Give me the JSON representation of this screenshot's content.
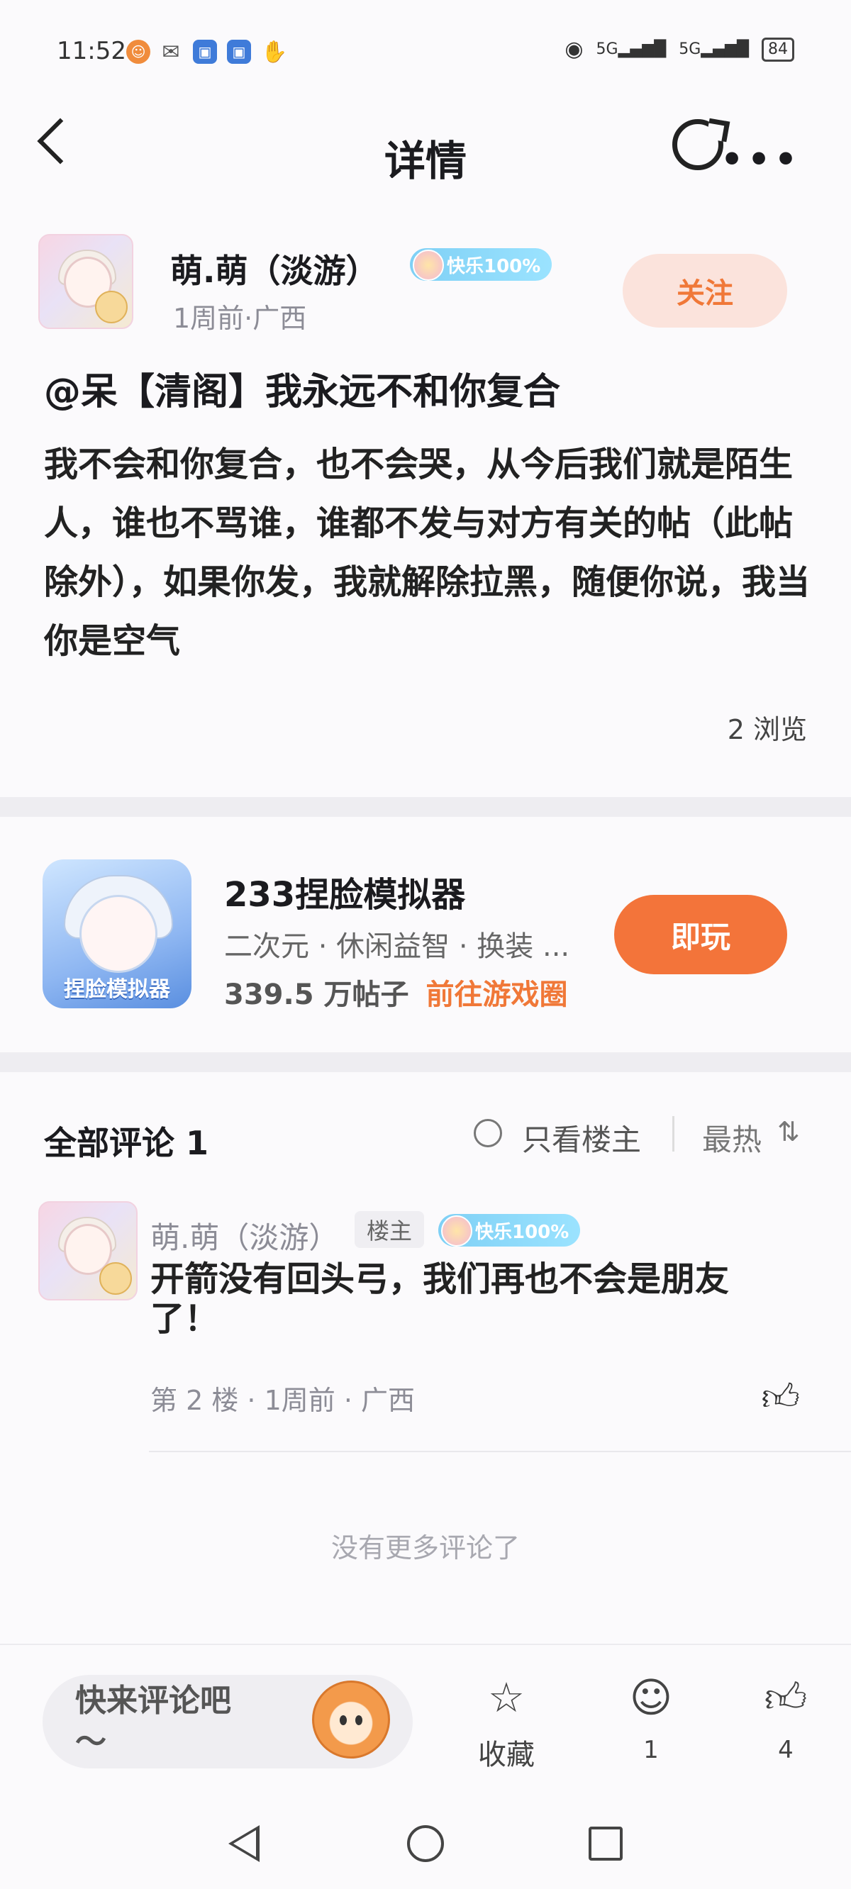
{
  "status_bar": {
    "time": "11:52",
    "signal1": "5G",
    "signal2": "5G",
    "battery": "84"
  },
  "header": {
    "title": "详情",
    "icons": [
      "back-icon",
      "share-icon",
      "more-icon"
    ]
  },
  "post": {
    "author_name": "萌.萌（淡游）",
    "badge": "快乐100%",
    "meta": "1周前·广西",
    "follow_label": "关注",
    "title": "@呆【清阁】我永远不和你复合",
    "body": "我不会和你复合，也不会哭，从今后我们就是陌生人，谁也不骂谁，谁都不发与对方有关的帖（此帖除外），如果你发，我就解除拉黑，随便你说，我当你是空气",
    "views": "2 浏览"
  },
  "game": {
    "name": "233捏脸模拟器",
    "tags": "二次元 · 休闲益智 · 换装 ...",
    "posts": "339.5 万帖子",
    "link": "前往游戏圈",
    "play_label": "即玩",
    "icon_label": "捏脸模拟器"
  },
  "comments": {
    "title": "全部评论",
    "count": "1",
    "only_op": "只看楼主",
    "sort": "最热",
    "items": [
      {
        "author": "萌.萌（淡游）",
        "op_tag": "楼主",
        "badge": "快乐100%",
        "text": "开箭没有回头弓，我们再也不会是朋友了！",
        "meta": "第 2 楼 · 1周前 · 广西"
      }
    ],
    "no_more": "没有更多评论了"
  },
  "bottom_bar": {
    "comment_placeholder": "快来评论吧～",
    "favorite_label": "收藏",
    "comment_count": "1",
    "like_count": "4"
  },
  "colors": {
    "accent": "#f3743a",
    "follow_bg": "#fbe3dc",
    "badge": "#8fd8f7"
  }
}
